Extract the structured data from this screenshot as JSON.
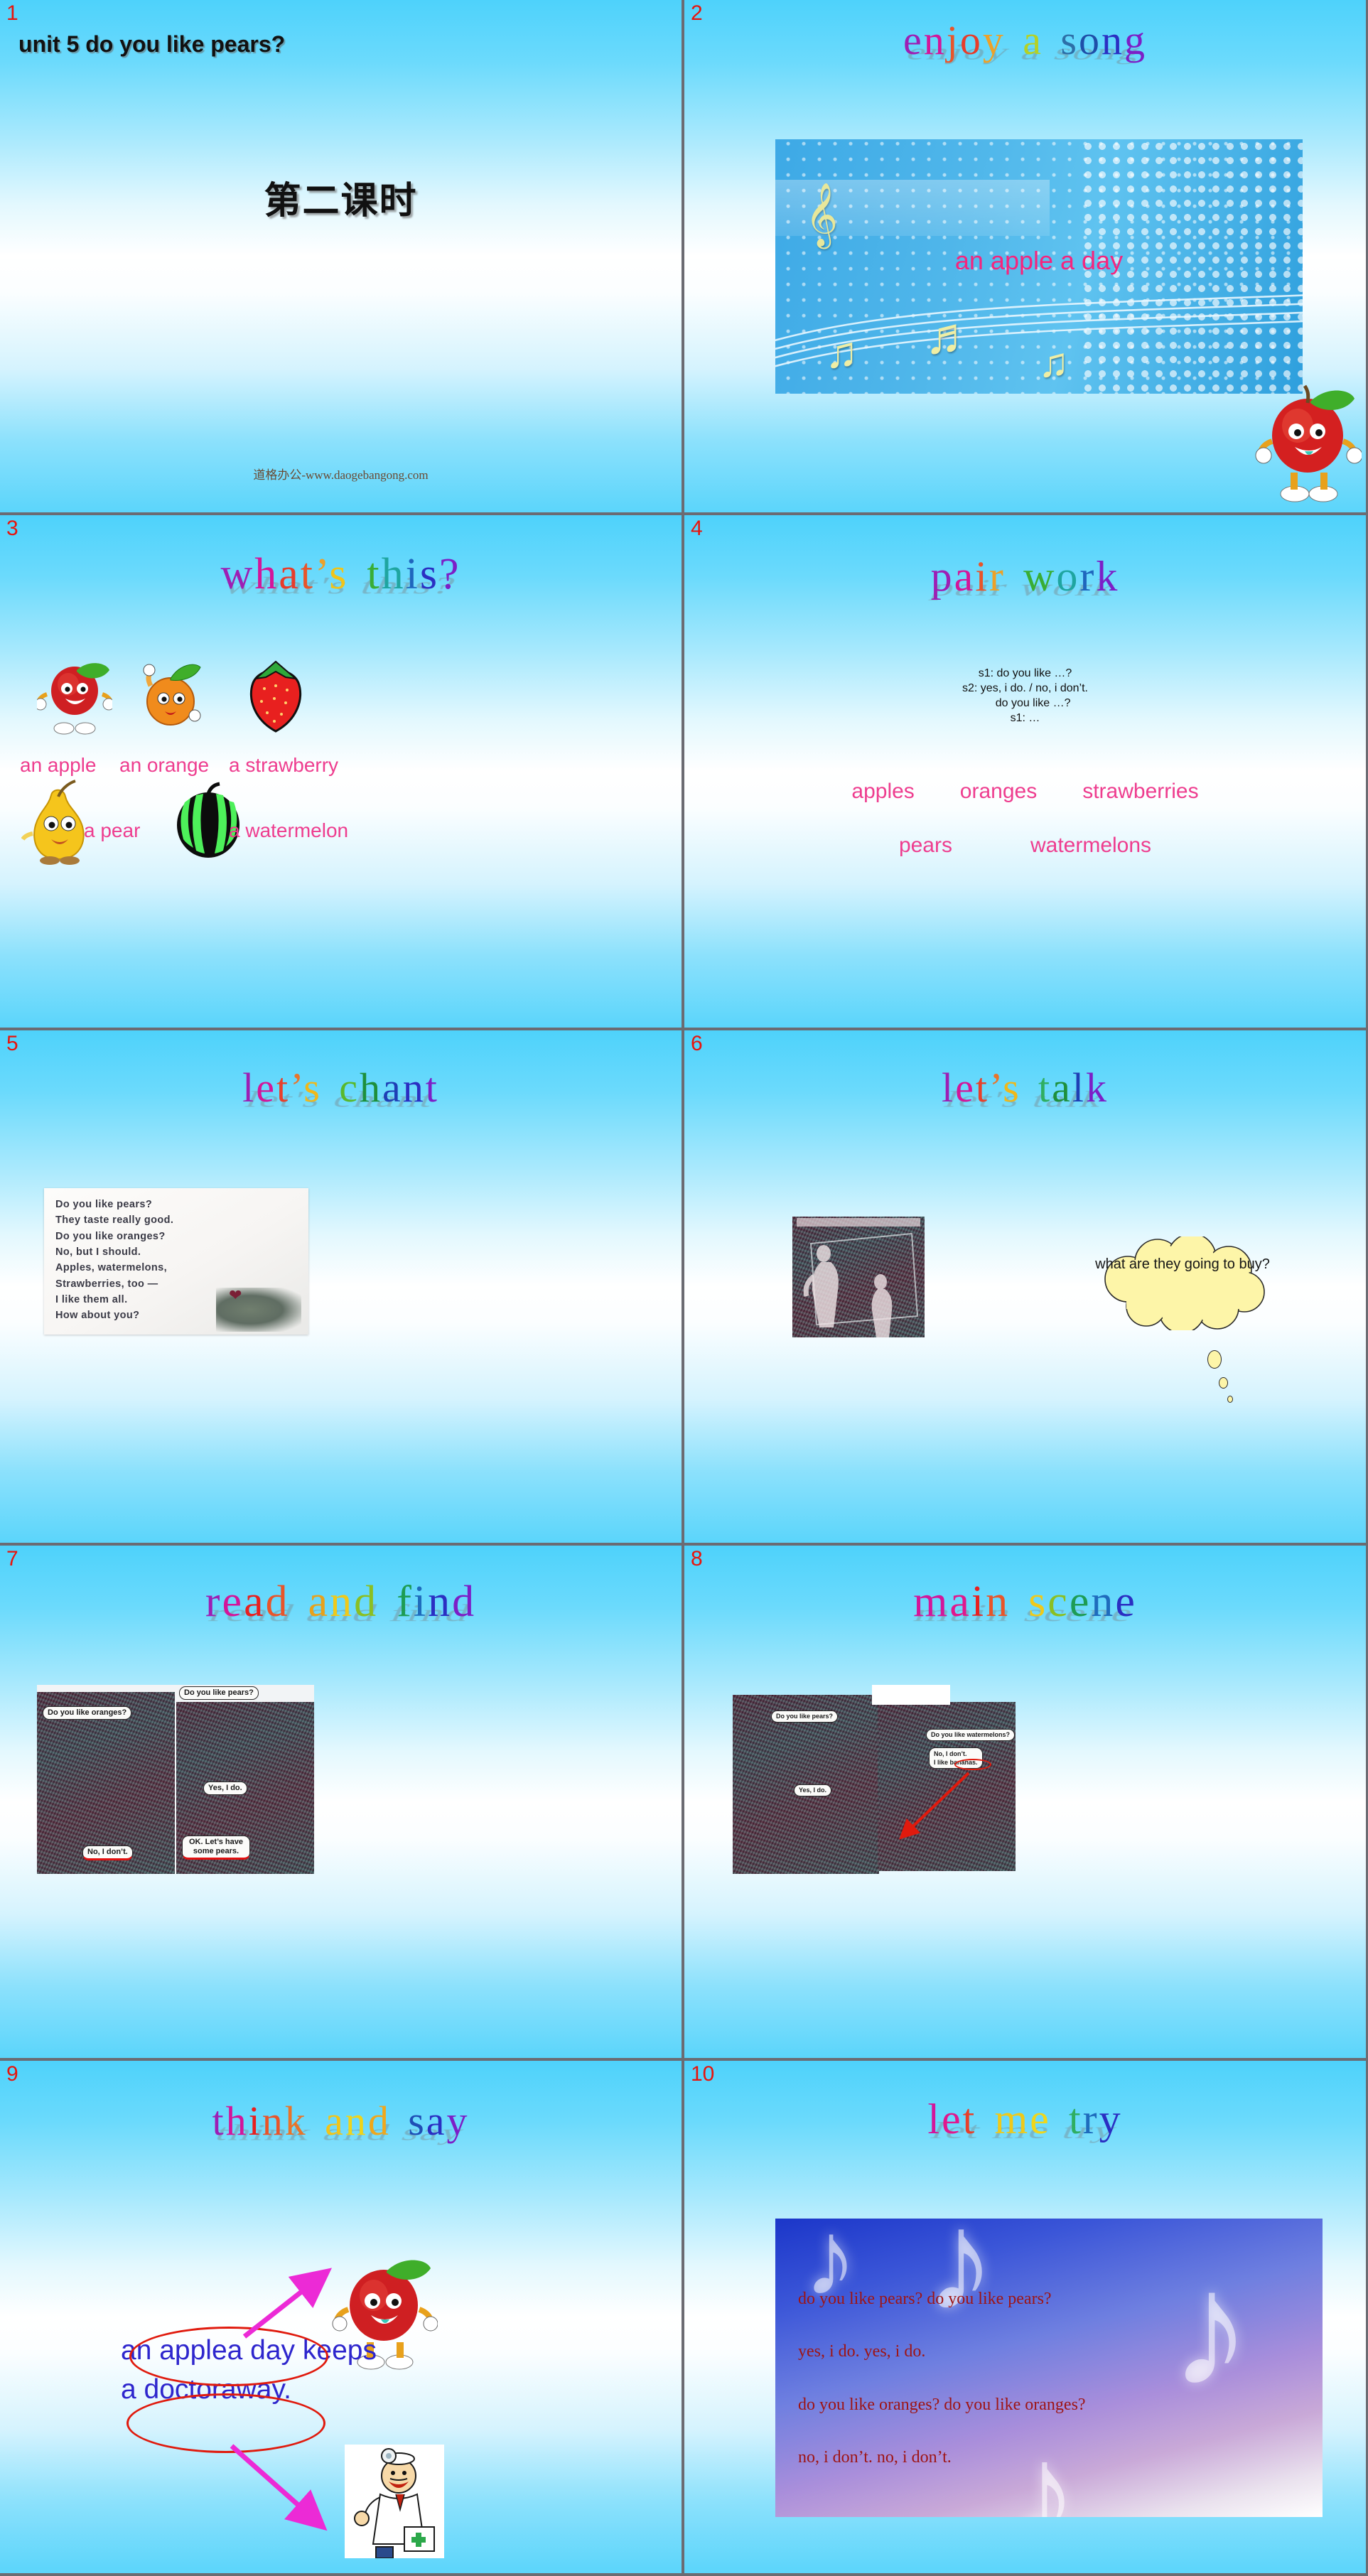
{
  "deck": {
    "slide_numbers": [
      "1",
      "2",
      "3",
      "4",
      "5",
      "6",
      "7",
      "8",
      "9",
      "10"
    ]
  },
  "slide1": {
    "number": "1",
    "title": "unit 5 do you like pears?",
    "subtitle": "第二课时",
    "watermark": "道格办公-www.daogebangong.com"
  },
  "slide2": {
    "number": "2",
    "title": "enjoy a song",
    "song_title": "an apple a day",
    "icons": [
      "treble-clef-icon",
      "music-note-icon",
      "apple-character-icon"
    ]
  },
  "slide3": {
    "number": "3",
    "title": "what's this?",
    "items": [
      {
        "label": "an apple",
        "icon": "apple-icon"
      },
      {
        "label": "an orange",
        "icon": "orange-icon"
      },
      {
        "label": "a strawberry",
        "icon": "strawberry-icon"
      },
      {
        "label": "a pear",
        "icon": "pear-icon"
      },
      {
        "label": "a watermelon",
        "icon": "watermelon-icon"
      }
    ]
  },
  "slide4": {
    "number": "4",
    "title": "pair work",
    "dialog": [
      "s1: do you like …?",
      "s2: yes, i do. / no, i don’t.",
      "     do you like …?",
      "s1: …"
    ],
    "words_row1": [
      "apples",
      "oranges",
      "strawberries"
    ],
    "words_row2": [
      "pears",
      "watermelons"
    ]
  },
  "slide5": {
    "number": "5",
    "title": "let's chant",
    "chant": [
      "Do you like pears?",
      "They taste really good.",
      "Do you like oranges?",
      "No, but I should.",
      "Apples, watermelons,",
      "Strawberries, too —",
      "I like them all.",
      "How about you?"
    ]
  },
  "slide6": {
    "number": "6",
    "title": "let's talk",
    "thought": "what are they going to buy?",
    "photo_alt": "market-stall-photo"
  },
  "slide7": {
    "number": "7",
    "title": "read and find",
    "panel1": {
      "bubble_top": "Do you like oranges?",
      "bubble_bottom": "No, I don’t."
    },
    "panel2": {
      "bubble_top": "Do you like pears?",
      "bubble_mid": "Yes, I do.",
      "bubble_bottom": "OK. Let’s have some pears."
    }
  },
  "slide8": {
    "number": "8",
    "title": "main scene",
    "panel1": {
      "bubble_top": "Do you like pears?",
      "bubble_bottom": "Yes, I do."
    },
    "panel2": {
      "bubble_top": "Do you like watermelons?",
      "bubble_bottom_line1": "No, I don’t.",
      "bubble_bottom_line2": "I like bananas."
    }
  },
  "slide9": {
    "number": "9",
    "title": "think and say",
    "sentence_line1_circled": "an apple",
    "sentence_line1_rest": "a day keeps",
    "sentence_line2_circled": "a doctor",
    "sentence_line2_rest": "away.",
    "icons": [
      "apple-character-icon",
      "doctor-icon",
      "arrow-icon"
    ]
  },
  "slide10": {
    "number": "10",
    "title": "let me try",
    "lines": [
      "do you like pears? do you like pears?",
      "yes, i do. yes, i do.",
      "do you like oranges? do you like oranges?",
      "no, i don’t. no, i don’t."
    ]
  },
  "colors": {
    "slide_number": "#e8140c",
    "pink_label": "#ee3d8f",
    "blue_sentence": "#2e26cd",
    "red_circle": "#e01a0d",
    "magenta_arrow": "#ec2ad6",
    "song_text": "#f5257e",
    "try_text": "#9e1414",
    "gutter": "#6b6b72",
    "bg_top": "#4ed2fb",
    "bg_mid": "#ffffff"
  }
}
